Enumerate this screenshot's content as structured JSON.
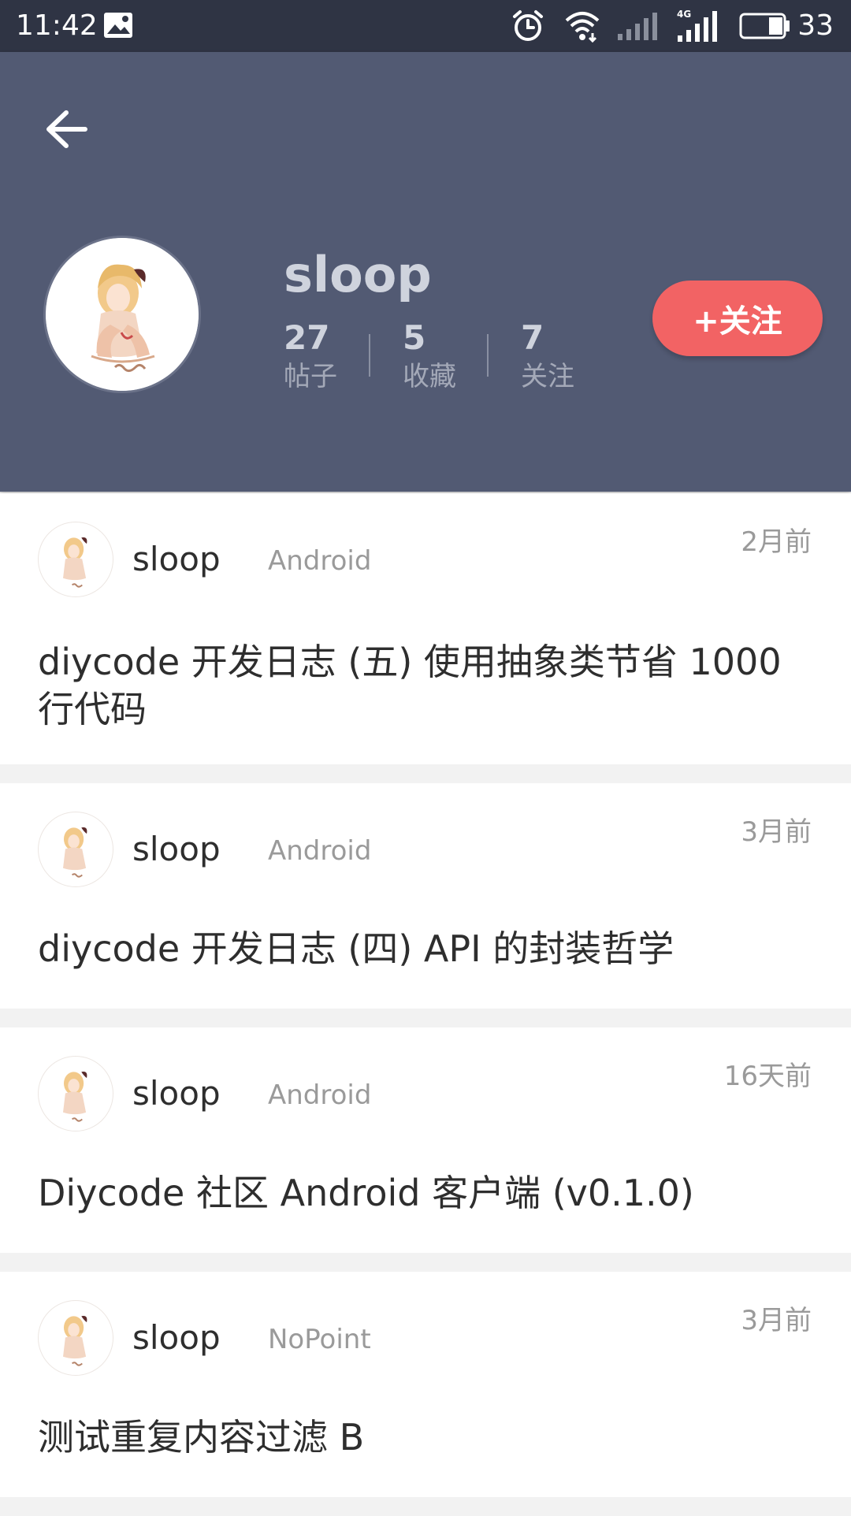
{
  "status_bar": {
    "time": "11:42",
    "battery": "33",
    "network": "4G",
    "icons": [
      "gallery-icon",
      "alarm-icon",
      "wifi-icon",
      "signal-icon",
      "signal-4g-icon",
      "battery-icon"
    ]
  },
  "header": {
    "back_icon": "arrow-left-icon",
    "username": "sloop",
    "follow_label": "+关注",
    "colors": {
      "header_bg": "#525a73",
      "status_bg": "#2f3444",
      "follow_bg": "#f26364"
    },
    "stats": [
      {
        "count": "27",
        "label": "帖子"
      },
      {
        "count": "5",
        "label": "收藏"
      },
      {
        "count": "7",
        "label": "关注"
      }
    ]
  },
  "posts": [
    {
      "author": "sloop",
      "node": "Android",
      "time": "2月前",
      "title": "diycode 开发日志 (五) 使用抽象类节省 1000 行代码"
    },
    {
      "author": "sloop",
      "node": "Android",
      "time": "3月前",
      "title": "diycode 开发日志 (四) API 的封装哲学"
    },
    {
      "author": "sloop",
      "node": "Android",
      "time": "16天前",
      "title": "Diycode 社区 Android 客户端 (v0.1.0)"
    },
    {
      "author": "sloop",
      "node": "NoPoint",
      "time": "3月前",
      "title": "测试重复内容过滤 B"
    }
  ]
}
